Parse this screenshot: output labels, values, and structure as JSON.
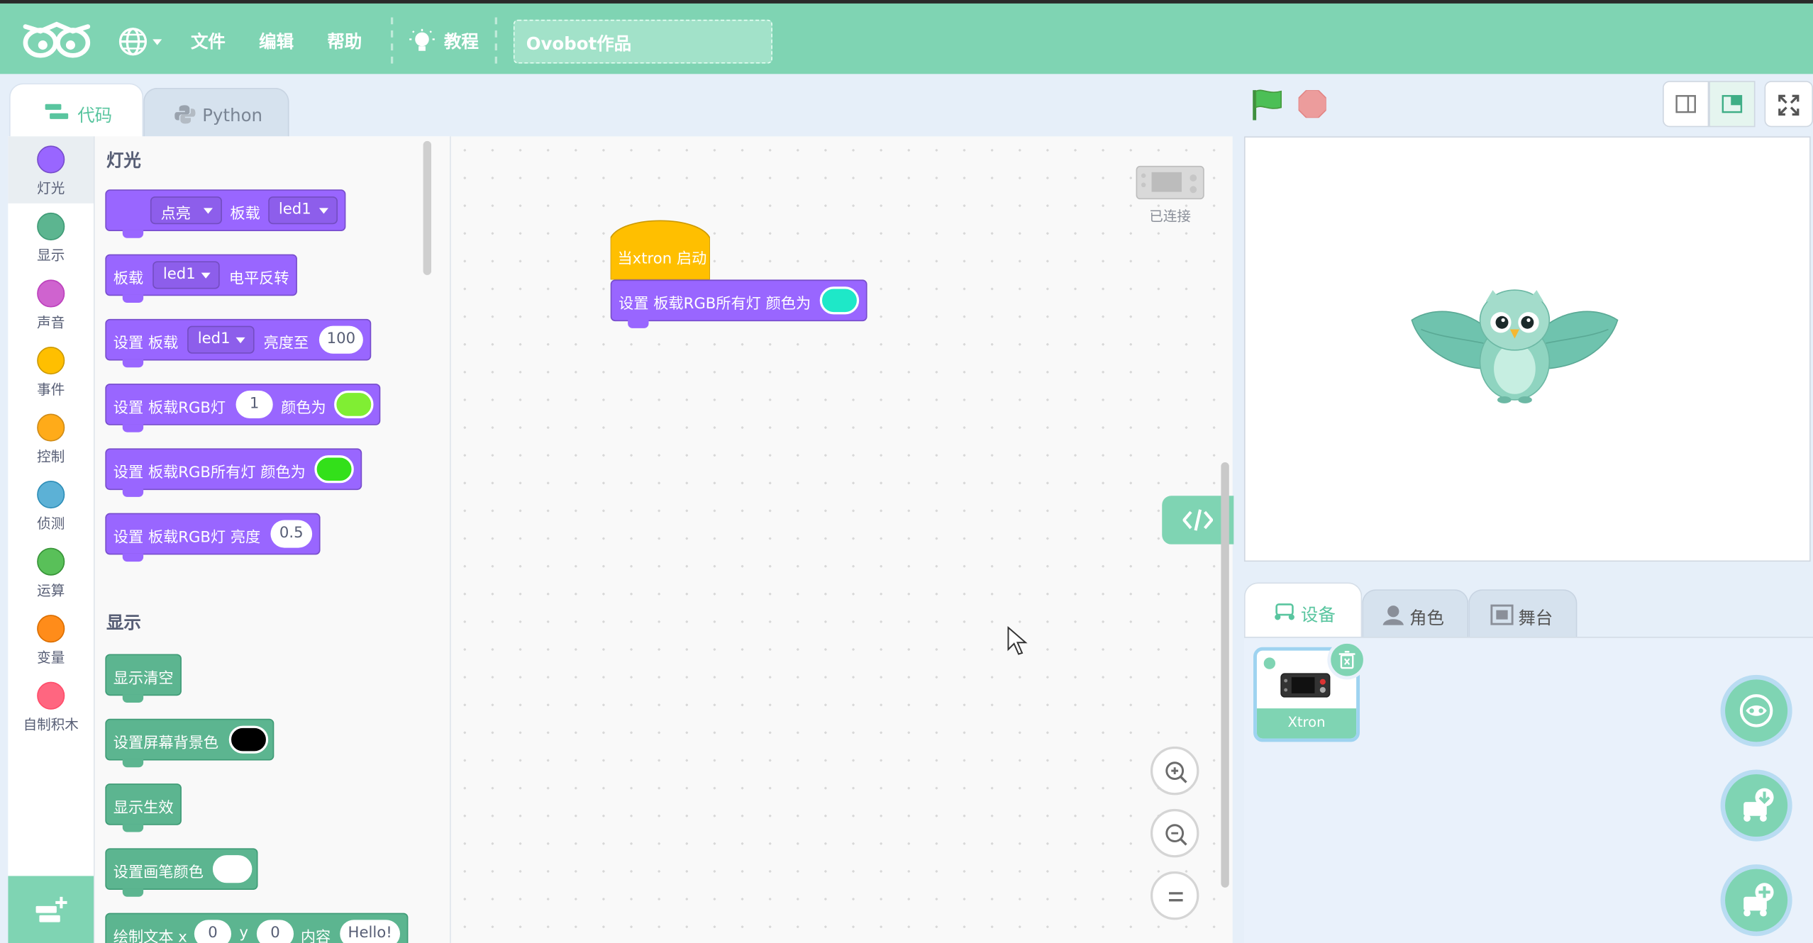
{
  "menu": {
    "file": "文件",
    "edit": "编辑",
    "help": "帮助",
    "tutorial": "教程",
    "project_title": "Ovobot作品"
  },
  "tabs": {
    "code": "代码",
    "python": "Python"
  },
  "categories": [
    {
      "label": "灯光",
      "color": "#9966ff"
    },
    {
      "label": "显示",
      "color": "#5cb590"
    },
    {
      "label": "声音",
      "color": "#cf63cf"
    },
    {
      "label": "事件",
      "color": "#ffbf00"
    },
    {
      "label": "控制",
      "color": "#ffab19"
    },
    {
      "label": "侦测",
      "color": "#5cb1d6"
    },
    {
      "label": "运算",
      "color": "#59c059"
    },
    {
      "label": "变量",
      "color": "#ff8c1a"
    },
    {
      "label": "自制积木",
      "color": "#ff6680"
    }
  ],
  "palette": {
    "section_light": "灯光",
    "section_display": "显示",
    "b1": {
      "menu": "点亮",
      "t1": "板载",
      "led": "led1"
    },
    "b2": {
      "t1": "板载",
      "led": "led1",
      "t2": "电平反转"
    },
    "b3": {
      "t1": "设置 板载",
      "led": "led1",
      "t2": "亮度至",
      "value": "100"
    },
    "b4": {
      "t1": "设置 板载RGB灯",
      "value": "1",
      "t2": "颜色为",
      "color": "#80ee33"
    },
    "b5": {
      "t1": "设置 板载RGB所有灯 颜色为",
      "color": "#33e01a"
    },
    "b6": {
      "t1": "设置 板载RGB灯 亮度",
      "value": "0.5"
    },
    "d1": "显示清空",
    "d2": {
      "t1": "设置屏幕背景色",
      "color": "#000000"
    },
    "d3": "显示生效",
    "d4": {
      "t1": "设置画笔颜色",
      "color": "#ffffff"
    },
    "d5": {
      "t1": "绘制文本 x",
      "x": "0",
      "t2": "y",
      "y": "0",
      "t3": "内容",
      "text": "Hello!"
    }
  },
  "workspace": {
    "connected": "已连接",
    "hat": "当xtron 启动",
    "block": "设置 板载RGB所有灯 颜色为",
    "block_color": "#1ee8c8"
  },
  "right_tabs": {
    "device": "设备",
    "role": "角色",
    "stage": "舞台"
  },
  "device": {
    "name": "Xtron"
  },
  "colors": {
    "accent": "#7fd4b3",
    "purple": "#9966ff",
    "green": "#5cb590"
  }
}
